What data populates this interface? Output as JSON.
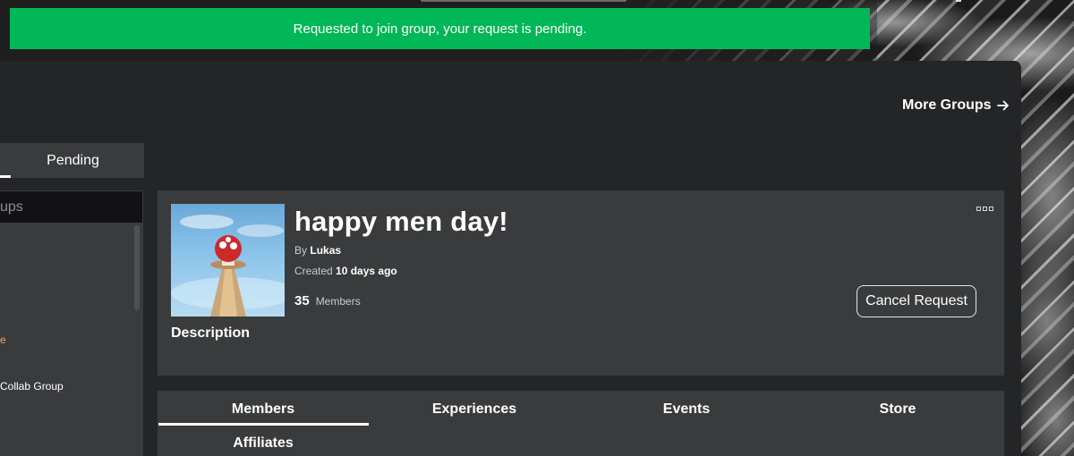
{
  "toast": {
    "message": "Requested to join group, your request is pending."
  },
  "header": {
    "more_groups_label": "More Groups"
  },
  "sidebar": {
    "tabs": [
      {
        "label": ""
      },
      {
        "label": "Pending"
      }
    ],
    "search": {
      "placeholder_visible": "ups"
    },
    "items": [
      {
        "label": "e"
      },
      {
        "label": " Collab Group"
      }
    ]
  },
  "group": {
    "name": "happy men day!",
    "by_label": "By",
    "owner": "Lukas",
    "created_label": "Created",
    "created_value": "10 days ago",
    "member_count": "35",
    "members_label": "Members",
    "description_label": "Description",
    "cancel_request_label": "Cancel Request"
  },
  "content_tabs": [
    {
      "label": "Members",
      "active": true
    },
    {
      "label": "Experiences"
    },
    {
      "label": "Events"
    },
    {
      "label": "Store"
    },
    {
      "label": "Affiliates"
    }
  ],
  "colors": {
    "toast": "#02b757",
    "panel": "#232527",
    "card": "#393b3d"
  }
}
